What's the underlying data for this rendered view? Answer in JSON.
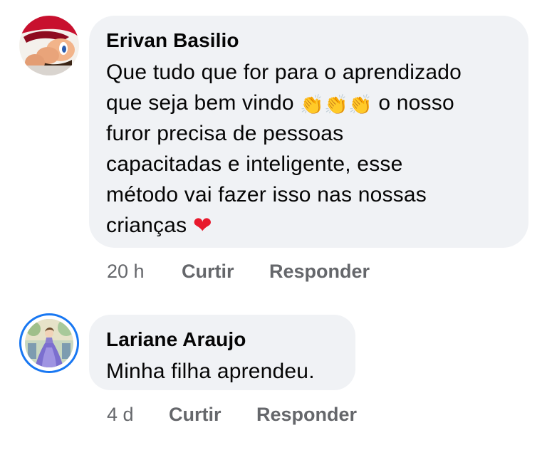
{
  "comments": [
    {
      "author": "Erivan Basilio",
      "text_line1": "Que tudo que for para o aprendizado",
      "text_line2_a": "que seja bem vindo",
      "text_line2_b": "o nosso",
      "text_line3": "furor precisa de pessoas",
      "text_line4": "capacitadas e inteligente, esse",
      "text_line5": "método vai fazer isso nas nossas",
      "text_line6": "crianças",
      "emoji_clap": "👏",
      "emoji_heart": "❤",
      "time": "20 h",
      "like_label": "Curtir",
      "reply_label": "Responder",
      "avatar_icon": "cartoon-mario-avatar"
    },
    {
      "author": "Lariane Araujo",
      "text": "Minha filha aprendeu.",
      "time": "4 d",
      "like_label": "Curtir",
      "reply_label": "Responder",
      "avatar_icon": "princess-painting-avatar",
      "avatar_ring_color": "#1877f2"
    }
  ]
}
